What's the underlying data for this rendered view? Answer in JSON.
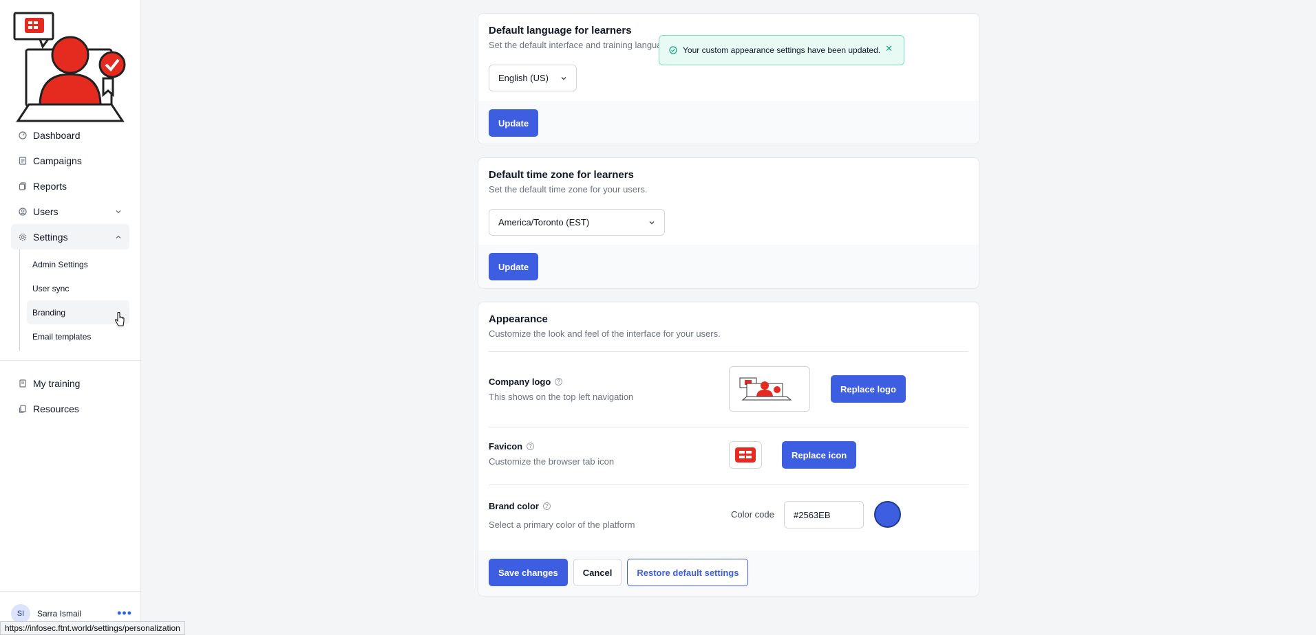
{
  "sidebar": {
    "items": [
      {
        "label": "Dashboard",
        "icon": "dashboard-icon"
      },
      {
        "label": "Campaigns",
        "icon": "campaigns-icon"
      },
      {
        "label": "Reports",
        "icon": "reports-icon"
      },
      {
        "label": "Users",
        "icon": "users-icon"
      },
      {
        "label": "Settings",
        "icon": "gear-icon"
      }
    ],
    "settings_sub": [
      {
        "label": "Admin Settings"
      },
      {
        "label": "User sync"
      },
      {
        "label": "Branding"
      },
      {
        "label": "Email templates"
      }
    ],
    "secondary": [
      {
        "label": "My training",
        "icon": "training-icon"
      },
      {
        "label": "Resources",
        "icon": "resources-icon"
      }
    ],
    "user": {
      "initials": "SI",
      "name": "Sarra Ismail"
    }
  },
  "language_card": {
    "title": "Default language for learners",
    "desc": "Set the default interface and training language for your users.",
    "selected": "English (US)",
    "button": "Update"
  },
  "timezone_card": {
    "title": "Default time zone for learners",
    "desc": "Set the default time zone for your users.",
    "selected": "America/Toronto (EST)",
    "button": "Update"
  },
  "appearance": {
    "title": "Appearance",
    "desc": "Customize the look and feel of the interface for your users.",
    "logo": {
      "title": "Company logo",
      "desc": "This shows on the top left navigation",
      "button": "Replace logo"
    },
    "favicon": {
      "title": "Favicon",
      "desc": "Customize the browser tab icon",
      "button": "Replace icon"
    },
    "brand": {
      "title": "Brand color",
      "desc": "Select a primary color of the platform",
      "code_label": "Color code",
      "code": "#2563EB",
      "swatch": "#2563EB"
    },
    "actions": {
      "save": "Save changes",
      "cancel": "Cancel",
      "restore": "Restore default settings"
    }
  },
  "toast": {
    "message": "Your custom appearance settings have been updated."
  },
  "status_url": "https://infosec.ftnt.world/settings/personalization",
  "colors": {
    "primary": "#3D5EE1",
    "logo_red": "#E52B20"
  }
}
